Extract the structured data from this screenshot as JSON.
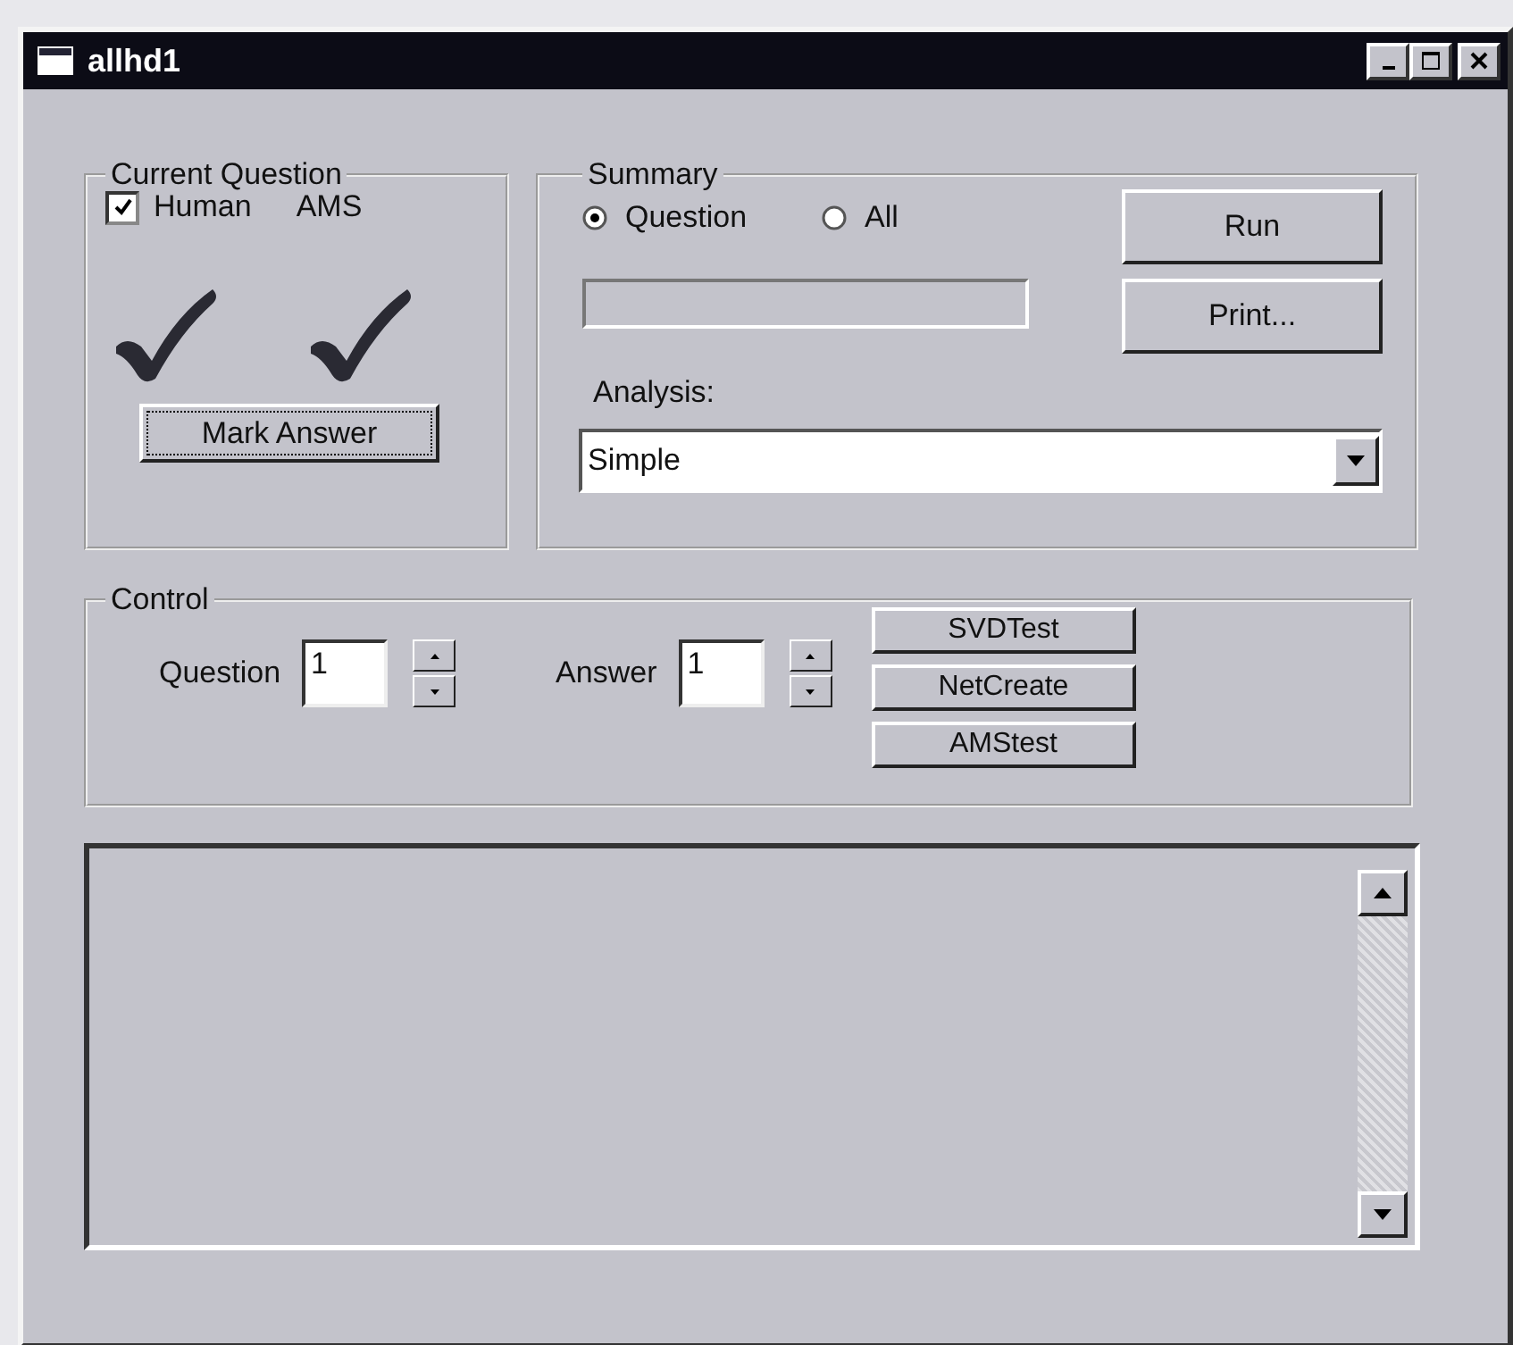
{
  "window": {
    "title": "allhd1"
  },
  "current_question": {
    "title": "Current Question",
    "human": {
      "label": "Human",
      "checked": true
    },
    "ams_label": "AMS",
    "mark_button": "Mark Answer"
  },
  "summary": {
    "title": "Summary",
    "radios": [
      {
        "label": "Question",
        "selected": true
      },
      {
        "label": "All",
        "selected": false
      }
    ],
    "run_button": "Run",
    "print_button": "Print...",
    "analysis_label": "Analysis:",
    "analysis_value": "Simple"
  },
  "control": {
    "title": "Control",
    "spinners": [
      {
        "label": "Question",
        "value": "1"
      },
      {
        "label": "Answer",
        "value": "1"
      }
    ],
    "buttons": [
      "SVDTest",
      "NetCreate",
      "AMStest"
    ]
  }
}
